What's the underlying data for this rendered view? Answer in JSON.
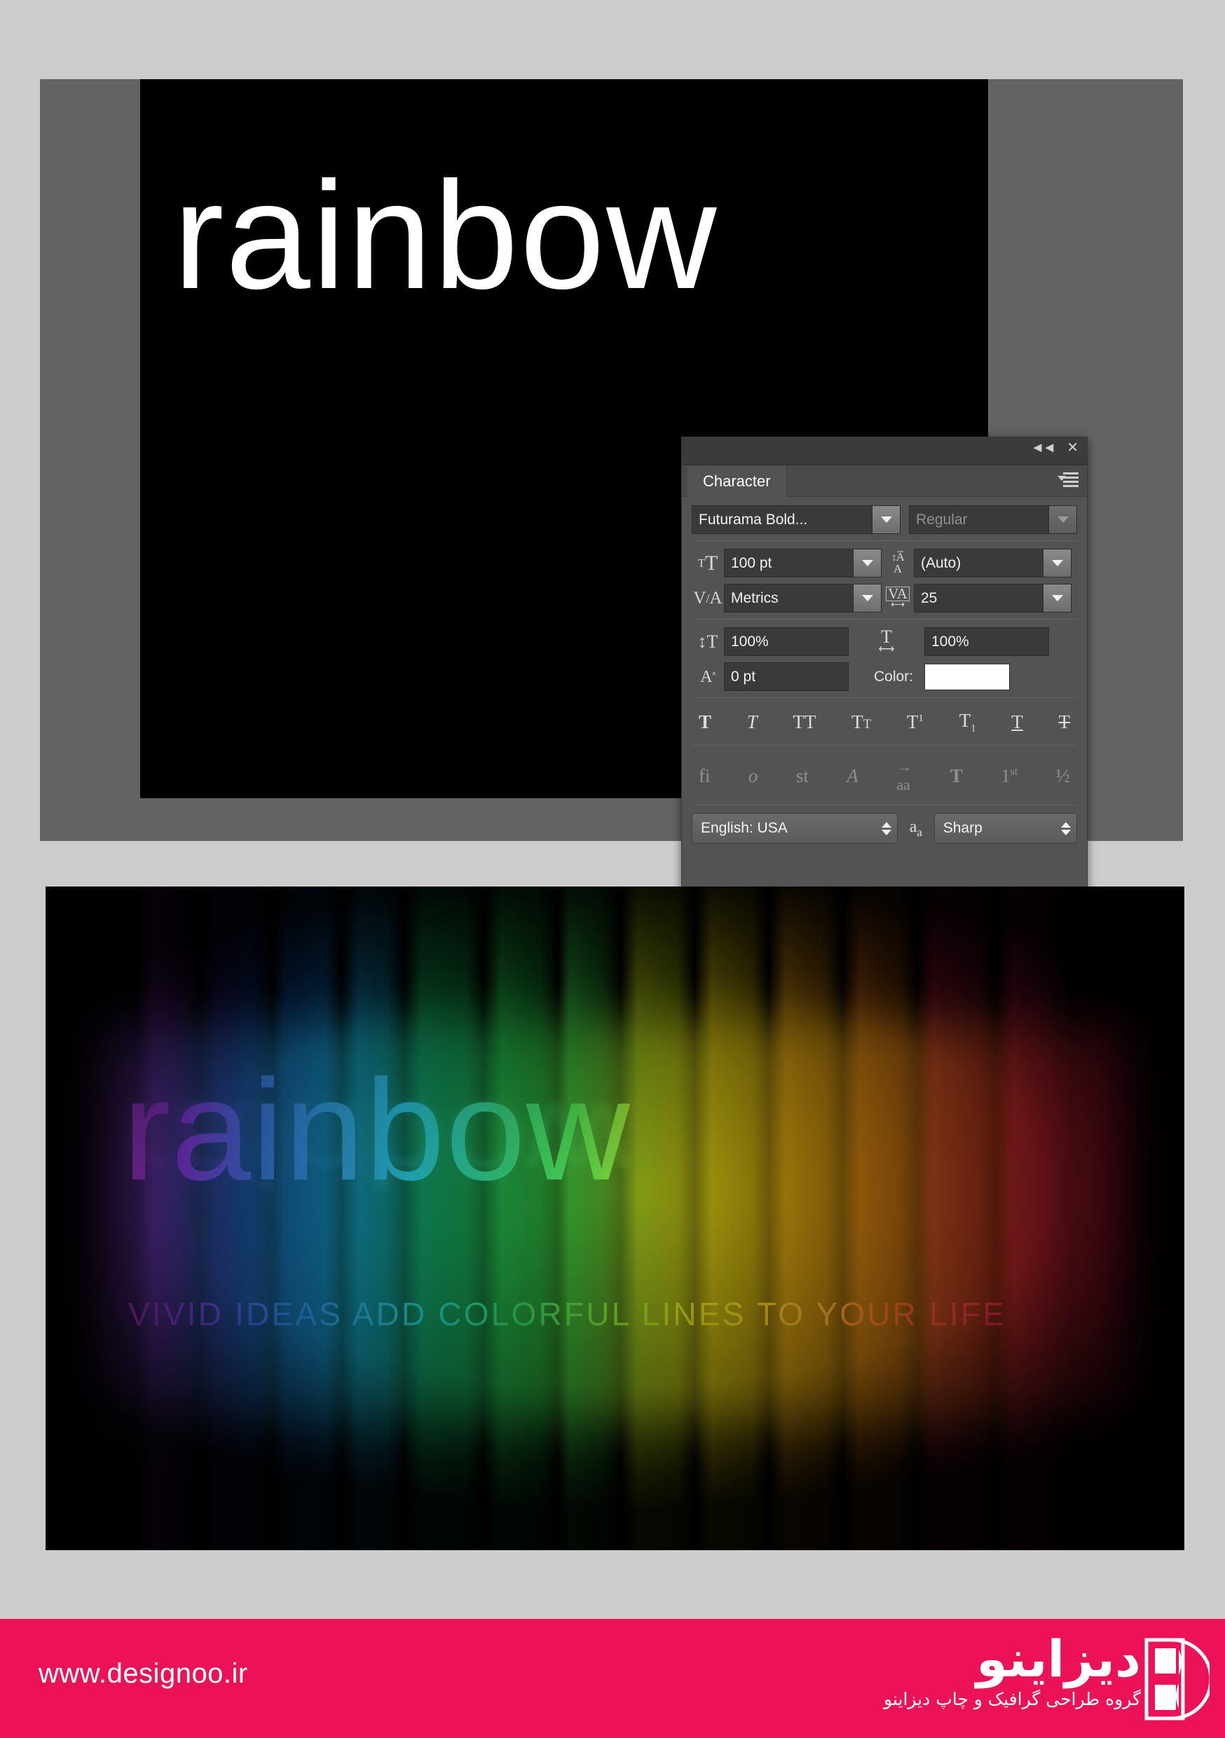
{
  "top_tutorial": {
    "wordmark": "rainbow",
    "canvas_bg": "#000000",
    "panel_bg": "#636363"
  },
  "character_panel": {
    "titlebar": {
      "collapse_icon": "collapse-double-arrow-icon",
      "close_icon": "close-icon"
    },
    "tab_label": "Character",
    "menu_icon": "panel-menu-icon",
    "font_family": {
      "value": "Futurama Bold...",
      "icon": "chevron-down-icon"
    },
    "font_style": {
      "value": "Regular",
      "icon": "chevron-down-icon"
    },
    "font_size": {
      "icon": "font-size-icon",
      "value": "100 pt"
    },
    "leading": {
      "icon": "leading-icon",
      "value": "(Auto)"
    },
    "kerning": {
      "icon": "kerning-icon",
      "value": "Metrics"
    },
    "tracking": {
      "icon": "tracking-icon",
      "value": "25"
    },
    "vertical_scale": {
      "icon": "vertical-scale-icon",
      "value": "100%"
    },
    "horizontal_scale": {
      "icon": "horizontal-scale-icon",
      "value": "100%"
    },
    "baseline_shift": {
      "icon": "baseline-shift-icon",
      "value": "0 pt"
    },
    "color": {
      "label": "Color:",
      "swatch_hex": "#ffffff"
    },
    "style_buttons": [
      {
        "name": "faux-bold-icon",
        "glyph": "T"
      },
      {
        "name": "faux-italic-icon",
        "glyph": "𝑇"
      },
      {
        "name": "all-caps-icon",
        "glyph": "TT"
      },
      {
        "name": "small-caps-icon",
        "glyph": "Tт"
      },
      {
        "name": "superscript-icon",
        "glyph": "T¹"
      },
      {
        "name": "subscript-icon",
        "glyph": "T₁"
      },
      {
        "name": "underline-icon",
        "glyph": "T"
      },
      {
        "name": "strikethrough-icon",
        "glyph": "₨"
      }
    ],
    "opentype_buttons": [
      {
        "name": "standard-ligatures-icon",
        "glyph": "fi"
      },
      {
        "name": "contextual-alternates-icon",
        "glyph": "𝑜̵"
      },
      {
        "name": "discretionary-ligatures-icon",
        "glyph": "st"
      },
      {
        "name": "swash-icon",
        "glyph": "𝒜"
      },
      {
        "name": "old-style-icon",
        "glyph": "aͣa"
      },
      {
        "name": "titling-alternates-icon",
        "glyph": "𝕋"
      },
      {
        "name": "ordinals-icon",
        "glyph": "1st"
      },
      {
        "name": "fractions-icon",
        "glyph": "½"
      }
    ],
    "language": {
      "value": "English: USA",
      "stepper_icon": "stepper-icon"
    },
    "antialias": {
      "icon": "anti-alias-icon",
      "value": "Sharp",
      "stepper_icon": "stepper-icon"
    }
  },
  "bottom_result": {
    "wordmark": "rainbow",
    "tagline": "VIVID IDEAS ADD COLORFUL LINES TO YOUR LIFE",
    "background": "#000000"
  },
  "footer": {
    "url": "www.designoo.ir",
    "brand_name": "دیزاینو",
    "brand_tagline": "گروه طراحی گرافیک و چاپ دیزاینو",
    "bg_color": "#ec1257",
    "logo_icon": "designoo-logo-icon"
  }
}
